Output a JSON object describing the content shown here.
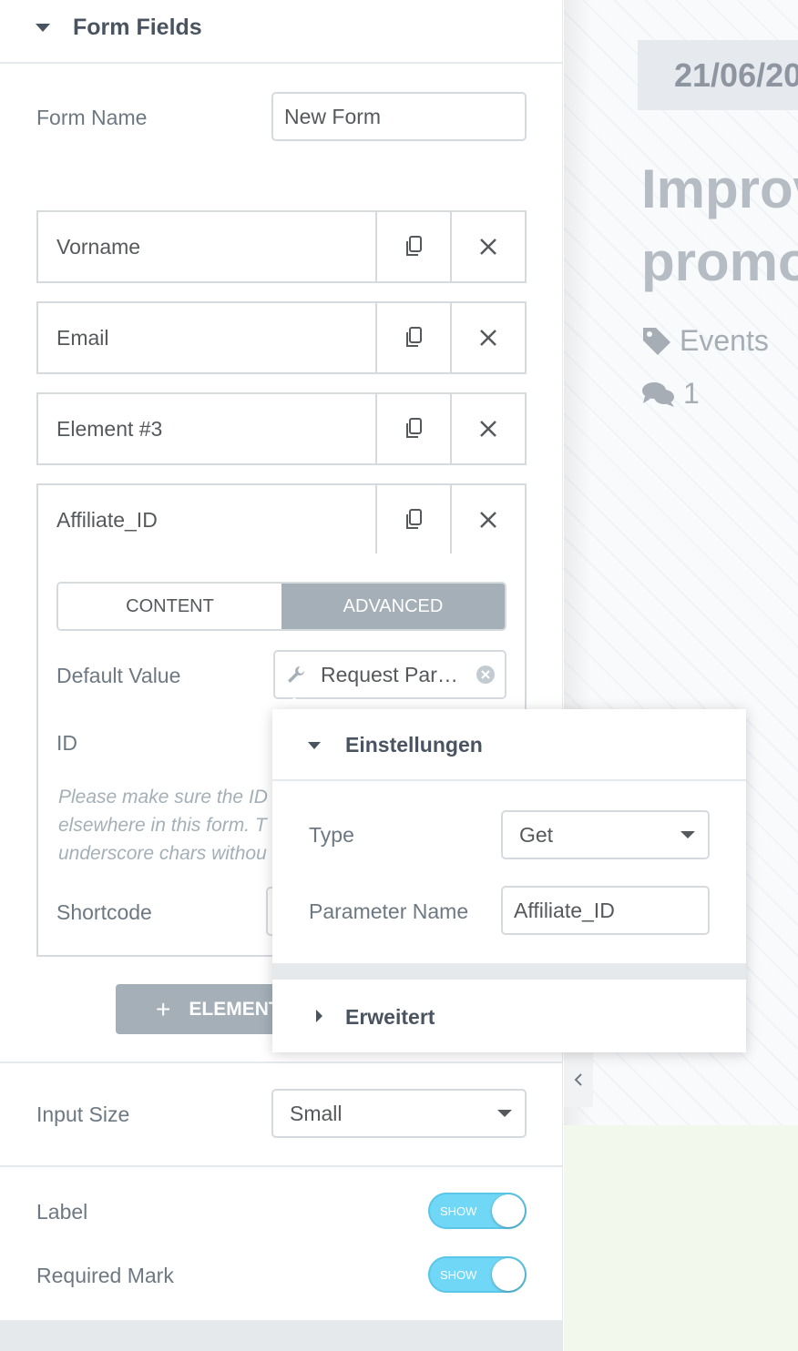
{
  "panel": {
    "section_title": "Form Fields",
    "form_name_label": "Form Name",
    "form_name_value": "New Form",
    "fields": [
      {
        "label": "Vorname"
      },
      {
        "label": "Email"
      },
      {
        "label": "Element #3"
      },
      {
        "label": "Affiliate_ID"
      }
    ],
    "tabs": {
      "content": "CONTENT",
      "advanced": "ADVANCED"
    },
    "default_value_label": "Default Value",
    "default_value": "Request Par…",
    "id_label": "ID",
    "help_text_lines": [
      "Please make sure the ID",
      "elsewhere in this form. T",
      "underscore chars withou"
    ],
    "shortcode_label": "Shortcode",
    "add_button_label": "ELEMENT",
    "input_size_label": "Input Size",
    "input_size_value": "Small",
    "label_label": "Label",
    "label_toggle": "SHOW",
    "required_label": "Required Mark",
    "required_toggle": "SHOW"
  },
  "popover": {
    "settings_title": "Einstellungen",
    "type_label": "Type",
    "type_value": "Get",
    "param_label": "Parameter Name",
    "param_value": "Affiliate_ID",
    "advanced_title": "Erweitert"
  },
  "preview": {
    "date": "21/06/20",
    "title_line1": "Improv",
    "title_line2": "promo",
    "category": "Events",
    "comments": "1"
  },
  "colors": {
    "accent_toggle": "#71d7f7",
    "tab_active": "#a4afb7",
    "text": "#6d7882"
  },
  "icons": [
    "caret-down-icon",
    "copy-icon",
    "close-icon",
    "wrench-icon",
    "clear-icon",
    "plus-icon",
    "tag-icon",
    "comments-icon",
    "chevron-left-icon",
    "caret-right-icon"
  ]
}
